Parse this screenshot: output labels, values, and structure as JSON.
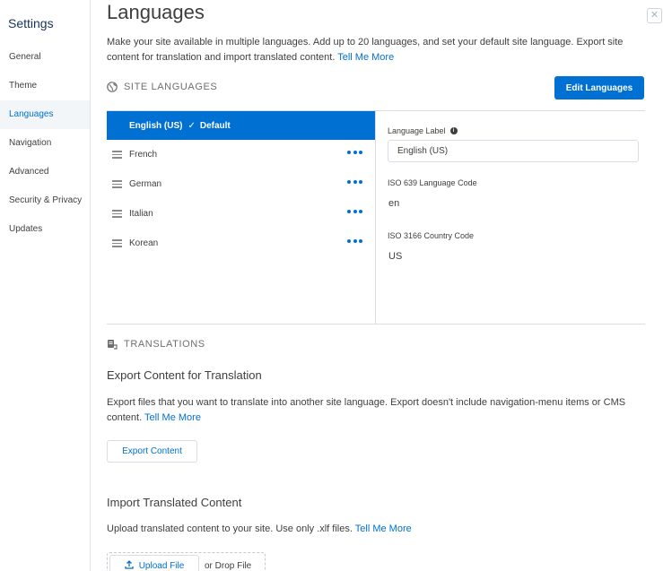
{
  "sidebar": {
    "title": "Settings",
    "items": [
      {
        "label": "General"
      },
      {
        "label": "Theme"
      },
      {
        "label": "Languages"
      },
      {
        "label": "Navigation"
      },
      {
        "label": "Advanced"
      },
      {
        "label": "Security & Privacy"
      },
      {
        "label": "Updates"
      }
    ],
    "active_item": "Languages"
  },
  "page": {
    "title": "Languages",
    "intro": "Make your site available in multiple languages. Add up to 20 languages, and set your default site language. Export site content for translation and import translated content.",
    "intro_link": "Tell Me More"
  },
  "site_languages": {
    "heading": "SITE LANGUAGES",
    "edit_button": "Edit Languages",
    "languages": [
      {
        "name": "English (US)",
        "badge": "Default"
      },
      {
        "name": "French"
      },
      {
        "name": "German"
      },
      {
        "name": "Italian"
      },
      {
        "name": "Korean"
      }
    ],
    "detail": {
      "label_field_label": "Language Label",
      "label_field_value": "English (US)",
      "iso639_label": "ISO 639 Language Code",
      "iso639_value": "en",
      "iso3166_label": "ISO 3166 Country Code",
      "iso3166_value": "US"
    }
  },
  "translations": {
    "heading": "TRANSLATIONS",
    "export": {
      "title": "Export Content for Translation",
      "description": "Export files that you want to translate into another site language. Export doesn't include navigation-menu items or CMS content.",
      "link": "Tell Me More",
      "button": "Export Content"
    },
    "import": {
      "title": "Import Translated Content",
      "description": "Upload translated content to your site. Use only .xlf files.",
      "link": "Tell Me More",
      "upload_button": "Upload File",
      "drop_text": "or Drop File"
    }
  },
  "colors": {
    "accent": "#0070d2",
    "active_bg": "#f3f6f9",
    "border": "#d8dde6"
  }
}
